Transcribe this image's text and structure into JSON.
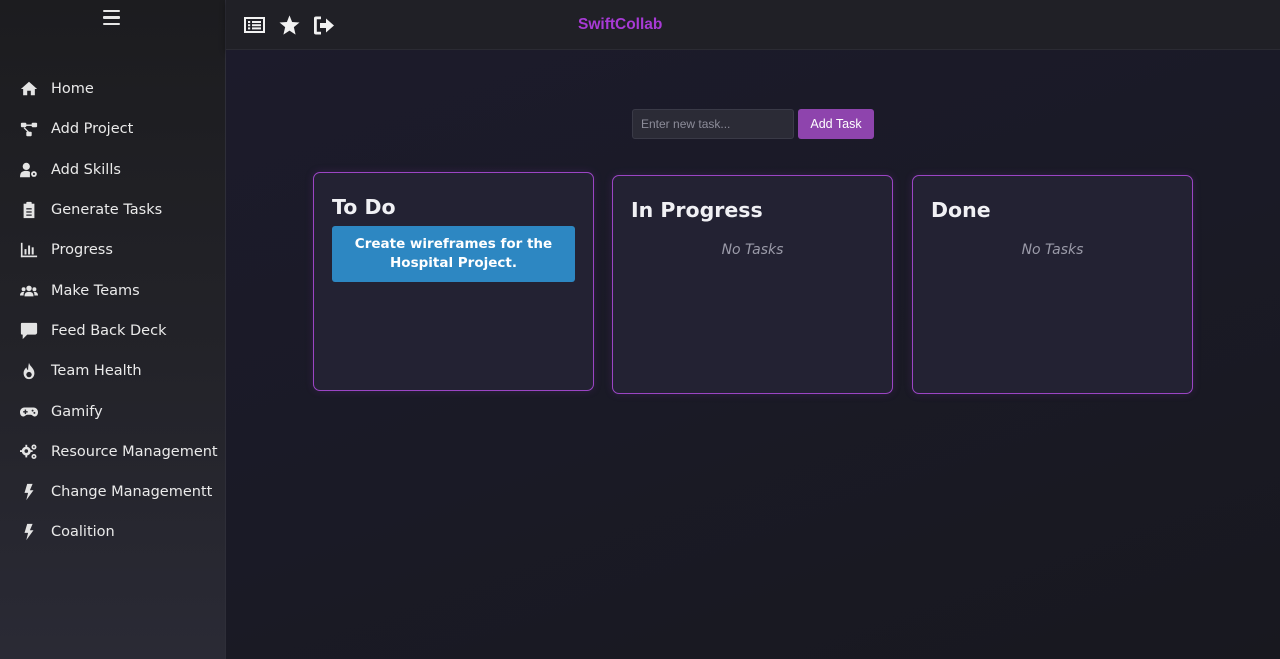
{
  "app": {
    "brand": "SwiftCollab"
  },
  "sidebar": {
    "items": [
      {
        "label": "Home",
        "icon": "home-icon"
      },
      {
        "label": "Add Project",
        "icon": "project-diagram-icon"
      },
      {
        "label": "Add Skills",
        "icon": "user-cog-icon"
      },
      {
        "label": "Generate Tasks",
        "icon": "clipboard-list-icon"
      },
      {
        "label": "Progress",
        "icon": "chart-bar-icon"
      },
      {
        "label": "Make Teams",
        "icon": "users-icon"
      },
      {
        "label": "Feed Back Deck",
        "icon": "comment-icon"
      },
      {
        "label": "Team Health",
        "icon": "fire-icon"
      },
      {
        "label": "Gamify",
        "icon": "gamepad-icon"
      },
      {
        "label": "Resource Management",
        "icon": "cogs-icon"
      },
      {
        "label": "Change Managementt",
        "icon": "bolt-icon"
      },
      {
        "label": "Coalition",
        "icon": "bolt-icon"
      }
    ]
  },
  "topbar": {
    "icons": [
      "list-icon",
      "star-icon",
      "sign-out-icon"
    ]
  },
  "task_form": {
    "placeholder": "Enter new task...",
    "button_label": "Add Task"
  },
  "board": {
    "columns": [
      {
        "title": "To Do",
        "tasks": [
          "Create wireframes for the Hospital Project."
        ]
      },
      {
        "title": "In Progress",
        "tasks": [],
        "empty_text": "No Tasks"
      },
      {
        "title": "Done",
        "tasks": [],
        "empty_text": "No Tasks"
      }
    ]
  },
  "colors": {
    "accent": "#8e44ad",
    "brand": "#a83ad6",
    "task_card": "#2d87c2",
    "column_border": "#9b45c4"
  }
}
